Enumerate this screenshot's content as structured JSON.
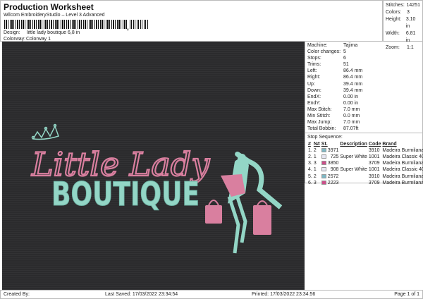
{
  "header": {
    "title": "Production Worksheet",
    "subtitle": "Wilcom EmbroideryStudio – Level 3 Advanced",
    "barcode_suffix": ",",
    "design_label": "Design:",
    "design_value": "little lady boutique 6,8 in",
    "colorway_label": "Colorway:",
    "colorway_value": "Colorway 1"
  },
  "stats": [
    {
      "k": "Stitches:",
      "v": "14251"
    },
    {
      "k": "Colors:",
      "v": "3"
    },
    {
      "k": "Height:",
      "v": "3.10 in"
    },
    {
      "k": "Width:",
      "v": "6.81 in"
    },
    {
      "k": "Zoom:",
      "v": "1:1"
    }
  ],
  "info": [
    {
      "k": "Machine:",
      "v": "Tajima"
    },
    {
      "k": "Color changes:",
      "v": "5"
    },
    {
      "k": "Stops:",
      "v": "6"
    },
    {
      "k": "Trims:",
      "v": "51"
    },
    {
      "k": "Left:",
      "v": "86.4 mm"
    },
    {
      "k": "Right:",
      "v": "86.4 mm"
    },
    {
      "k": "Up:",
      "v": "39.4 mm"
    },
    {
      "k": "Down:",
      "v": "39.4 mm"
    },
    {
      "k": "EndX:",
      "v": "0.00 in"
    },
    {
      "k": "EndY:",
      "v": "0.00 in"
    },
    {
      "k": "Max Stitch:",
      "v": "7.0 mm"
    },
    {
      "k": "Min Stitch:",
      "v": "0.0 mm"
    },
    {
      "k": "Max Jump:",
      "v": "7.0 mm"
    },
    {
      "k": "Total Bobbin:",
      "v": "87.07ft"
    }
  ],
  "stop_sequence": {
    "title": "Stop Sequence:",
    "headers": [
      "#",
      "N#",
      "St.",
      "Description",
      "Code",
      "Brand"
    ],
    "rows": [
      {
        "n": "1.",
        "needle": "2",
        "color": "#7fb8c4",
        "st": "3971",
        "desc": "",
        "code": "3910",
        "brand": "Madeira Burmilana"
      },
      {
        "n": "2.",
        "needle": "1",
        "color": "#e6e6f2",
        "st": "725",
        "desc": "Super White",
        "code": "1001",
        "brand": "Madeira Classic 40"
      },
      {
        "n": "3.",
        "needle": "3",
        "color": "#cc4f8a",
        "st": "3850",
        "desc": "",
        "code": "3709",
        "brand": "Madeira Burmilana"
      },
      {
        "n": "4.",
        "needle": "1",
        "color": "#e6e6f2",
        "st": "908",
        "desc": "Super White",
        "code": "1001",
        "brand": "Madeira Classic 40"
      },
      {
        "n": "5.",
        "needle": "2",
        "color": "#7fb8c4",
        "st": "2572",
        "desc": "",
        "code": "3910",
        "brand": "Madeira Burmilana"
      },
      {
        "n": "6.",
        "needle": "3",
        "color": "#cc4f8a",
        "st": "2223",
        "desc": "",
        "code": "3709",
        "brand": "Madeira Burmilana"
      }
    ]
  },
  "design_art": {
    "line1": "Little Lady",
    "line2": "BOUTIQUE",
    "teal": "#93d6c6",
    "pink": "#d97f9f",
    "background": "#2b2b2d"
  },
  "footer": {
    "created_by": "Created By:",
    "last_saved": "Last Saved: 17/03/2022 23:34:54",
    "printed": "Printed: 17/03/2022 23:34:56",
    "page": "Page 1 of 1"
  }
}
